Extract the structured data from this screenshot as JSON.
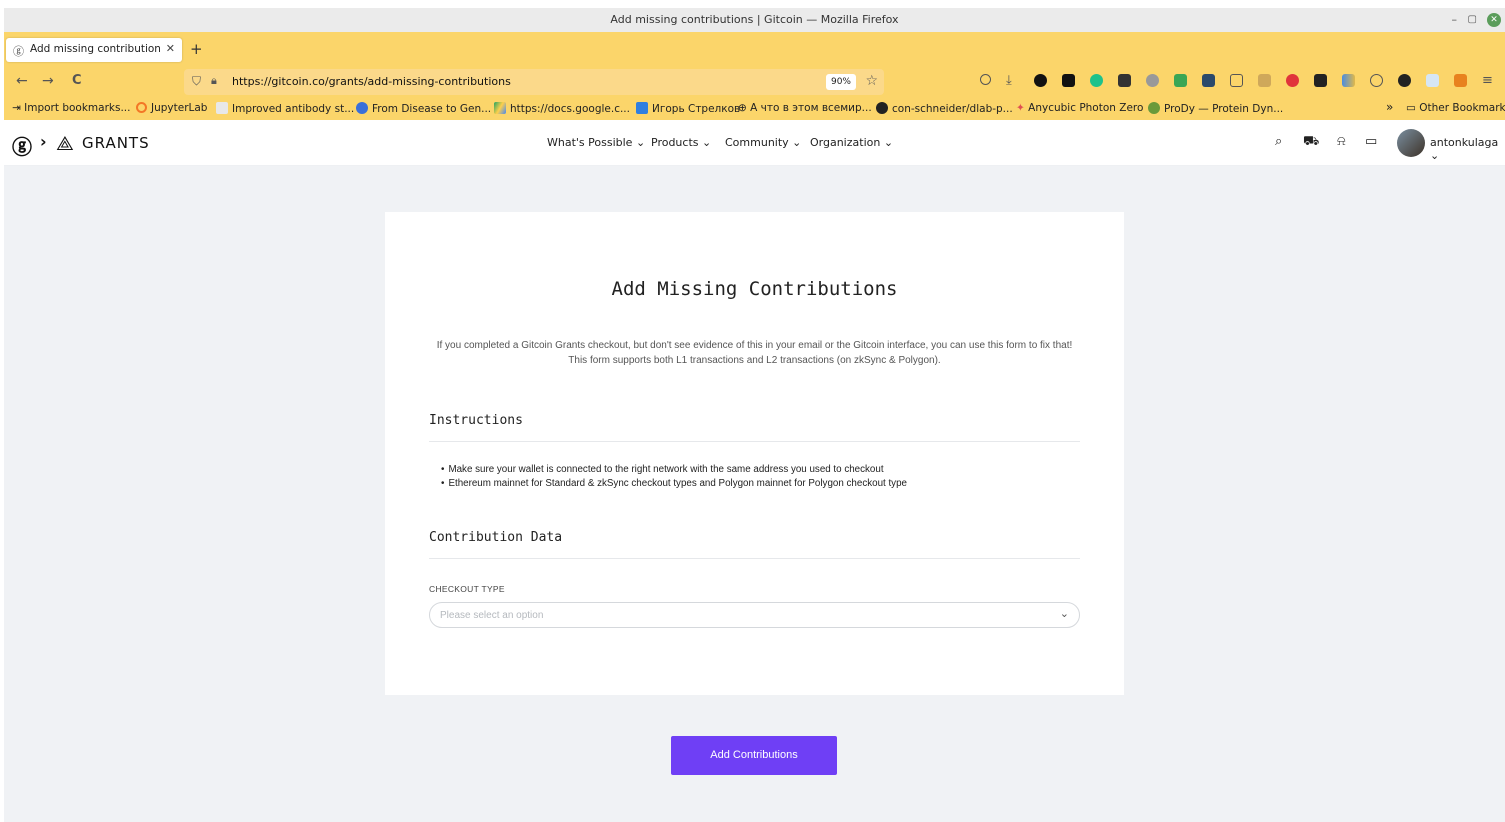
{
  "window": {
    "title": "Add missing contributions | Gitcoin — Mozilla Firefox",
    "controls": {
      "minimize": "–",
      "maximize": "▢",
      "close": "✕"
    }
  },
  "tab": {
    "title": "Add missing contributions | ",
    "close": "✕",
    "new_tab": "+"
  },
  "nav": {
    "back": "←",
    "forward": "→",
    "reload": "C",
    "url": "https://gitcoin.co/grants/add-missing-contributions",
    "zoom": "90%",
    "star": "☆"
  },
  "bookmarks": [
    "Import bookmarks...",
    "JupyterLab",
    "Improved antibody st...",
    "From Disease to Gen...",
    "https://docs.google.c...",
    "Игорь Стрелков",
    "А что в этом всемир...",
    "con-schneider/dlab-p...",
    "Anycubic Photon Zero",
    "ProDy — Protein Dyn..."
  ],
  "bookmarks_overflow": "»",
  "other_bookmarks": "Other Bookmarks",
  "site": {
    "logo_text": "GRANTS",
    "nav": [
      "What's Possible ⌄",
      "Products ⌄",
      "Community ⌄",
      "Organization ⌄"
    ],
    "username": "antonkulaga ⌄"
  },
  "card": {
    "title": "Add Missing Contributions",
    "description": "If you completed a Gitcoin Grants checkout, but don't see evidence of this in your email or the Gitcoin interface, you can use this form to fix that! This form supports both L1 transactions and L2 transactions (on zkSync & Polygon).",
    "instructions_title": "Instructions",
    "instructions": [
      "Make sure your wallet is connected to the right network with the same address you used to checkout",
      "Ethereum mainnet for Standard & zkSync checkout types and Polygon mainnet for Polygon checkout type"
    ],
    "contribution_title": "Contribution Data",
    "checkout_label": "CHECKOUT TYPE",
    "checkout_placeholder": "Please select an option"
  },
  "submit_label": "Add Contributions",
  "colors": {
    "browser_chrome": "#fbd56a",
    "page_bg": "#f0f2f5",
    "primary": "#6f3ff5"
  }
}
